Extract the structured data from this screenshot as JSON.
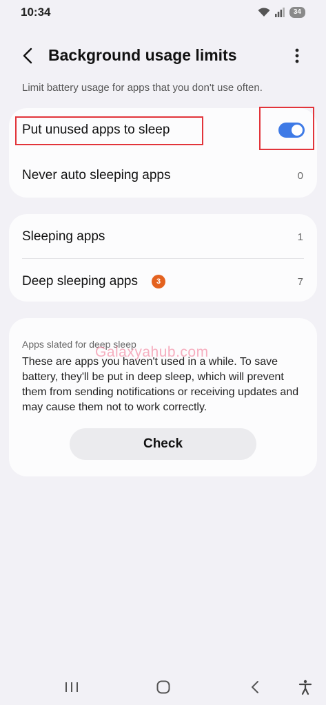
{
  "status_bar": {
    "time": "10:34",
    "battery_level": "34",
    "icons": [
      "wifi-icon",
      "signal-icon",
      "battery-icon"
    ]
  },
  "header": {
    "title": "Background usage limits",
    "back_icon": "chevron-left-icon",
    "more_icon": "more-vertical-icon"
  },
  "subtitle": "Limit battery usage for apps that you don't use often.",
  "settings_card": {
    "put_to_sleep": {
      "label": "Put unused apps to sleep",
      "enabled": true
    },
    "never_auto_sleeping": {
      "label": "Never auto sleeping apps",
      "count": "0"
    }
  },
  "sleep_lists_card": {
    "sleeping": {
      "label": "Sleeping apps",
      "count": "1"
    },
    "deep_sleeping": {
      "label": "Deep sleeping apps",
      "badge": "3",
      "count": "7"
    }
  },
  "deep_sleep_card": {
    "header": "Apps slated for deep sleep",
    "description": "These are apps you haven't used in a while. To save battery, they'll be put in deep sleep, which will prevent them from sending notifications or receiving updates and may cause them not to work correctly.",
    "check_label": "Check"
  },
  "watermark": "Galaxyahub.com",
  "nav_bar": {
    "recents_icon": "recents-icon",
    "home_icon": "home-icon",
    "back_icon": "back-icon",
    "accessibility_icon": "accessibility-icon"
  },
  "colors": {
    "accent": "#3e7ae6",
    "badge": "#e4621f",
    "highlight": "#e2343a",
    "background": "#f2f1f6",
    "card": "#fcfcfd"
  }
}
